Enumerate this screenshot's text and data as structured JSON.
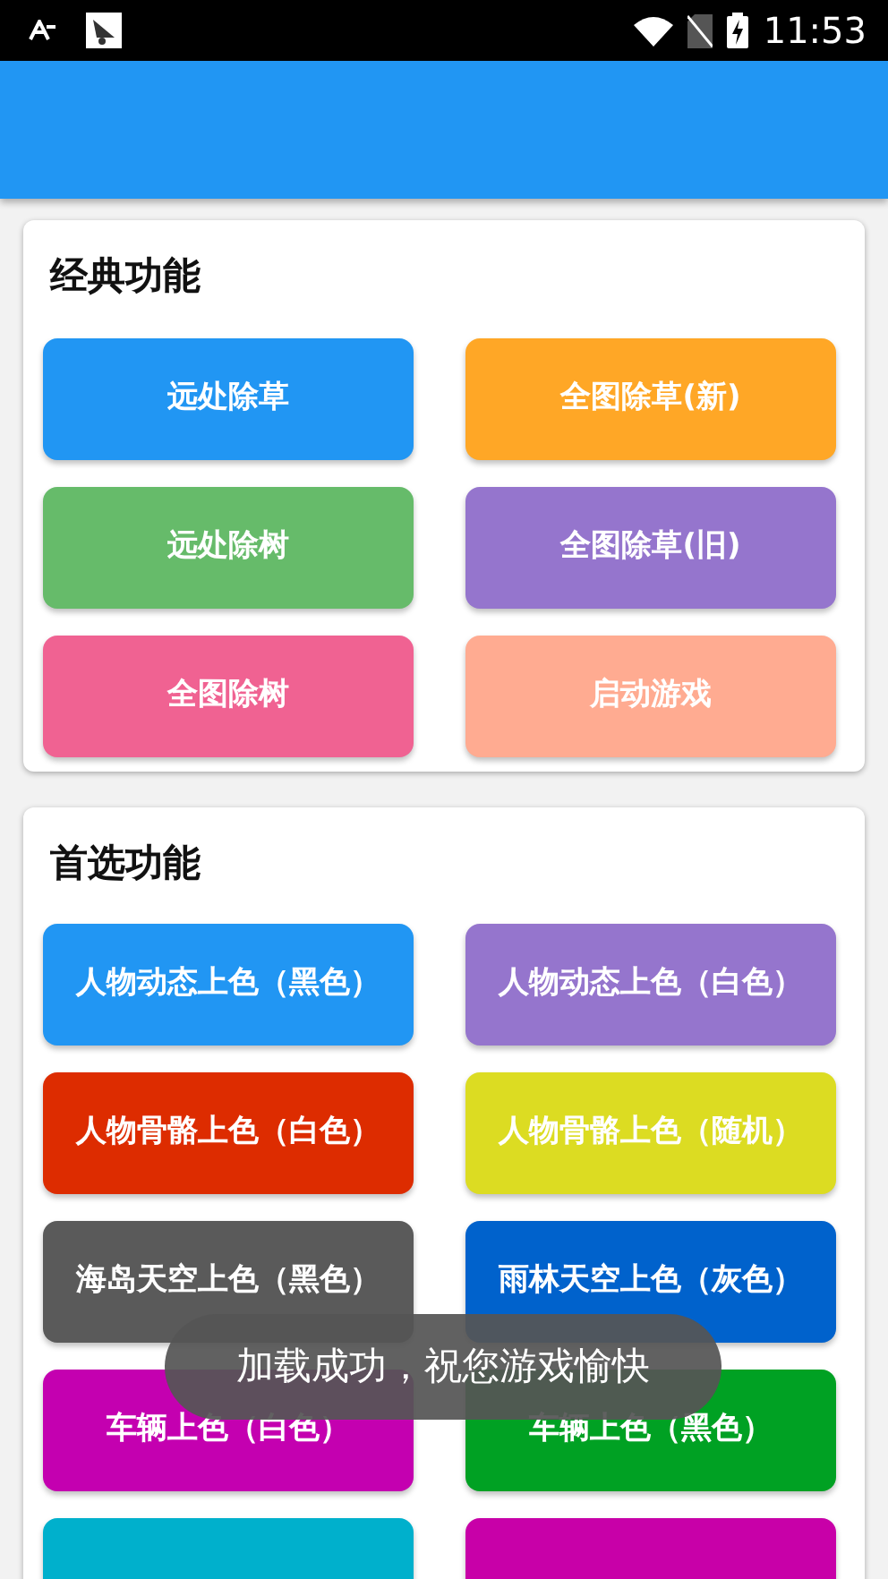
{
  "status_bar": {
    "time": "11:53"
  },
  "sections": [
    {
      "title": "经典功能",
      "buttons": [
        {
          "label": "远处除草",
          "color": "#2196f3"
        },
        {
          "label": "全图除草(新)",
          "color": "#ffa726"
        },
        {
          "label": "远处除树",
          "color": "#66bb6a"
        },
        {
          "label": "全图除草(旧)",
          "color": "#9575cd"
        },
        {
          "label": "全图除树",
          "color": "#f06292"
        },
        {
          "label": "启动游戏",
          "color": "#ffab91"
        }
      ]
    },
    {
      "title": "首选功能",
      "buttons": [
        {
          "label": "人物动态上色（黑色）",
          "color": "#2196f3"
        },
        {
          "label": "人物动态上色（白色）",
          "color": "#9575cd"
        },
        {
          "label": "人物骨骼上色（白色）",
          "color": "#dd2c00"
        },
        {
          "label": "人物骨骼上色（随机）",
          "color": "#dcdc22"
        },
        {
          "label": "海岛天空上色（黑色）",
          "color": "#5a5a5a"
        },
        {
          "label": "雨林天空上色（灰色）",
          "color": "#0062cc"
        },
        {
          "label": "车辆上色（白色）",
          "color": "#c400b0"
        },
        {
          "label": "车辆上色（黑色）",
          "color": "#00a123"
        },
        {
          "color": "#00b0cc"
        },
        {
          "color": "#c800a8"
        }
      ]
    }
  ],
  "toast": {
    "text": "加载成功，祝您游戏愉快"
  }
}
